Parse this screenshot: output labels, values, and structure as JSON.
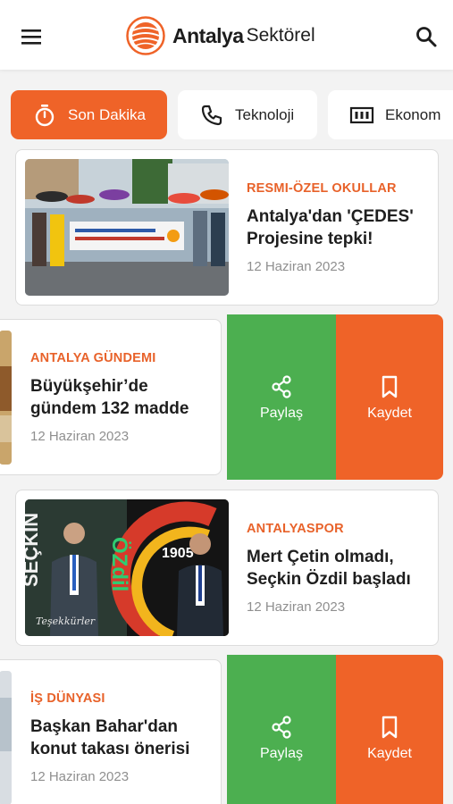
{
  "header": {
    "brand_bold": "Antalya",
    "brand_light": "Sektörel",
    "menu_icon": "hamburger-menu-icon",
    "search_icon": "search-icon"
  },
  "colors": {
    "accent": "#ef6328",
    "share_green": "#4caf50",
    "category_text": "#e8622a"
  },
  "tabs": [
    {
      "label": "Son Dakika",
      "icon": "stopwatch-icon",
      "active": true
    },
    {
      "label": "Teknoloji",
      "icon": "phone-icon",
      "active": false
    },
    {
      "label": "Ekonom",
      "icon": "currency-icon",
      "active": false
    }
  ],
  "articles": [
    {
      "category": "RESMI-ÖZEL OKULLAR",
      "title_line1": "Antalya'dan 'ÇEDES'",
      "title_line2": "Projesine tepki!",
      "date": "12 Haziran 2023",
      "image_banner": "Laik, bilimsel eğitime aykırı uygulamaları reddediyoruz!"
    },
    {
      "category": "ANTALYA GÜNDEMI",
      "title_line1": "Büyükşehir’de",
      "title_line2": "gündem 132 madde",
      "date": "12 Haziran 2023",
      "actions": {
        "share": "Paylaş",
        "save": "Kaydet"
      }
    },
    {
      "category": "ANTALYASPOR",
      "title_line1": "Mert Çetin olmadı,",
      "title_line2": "Seçkin Özdil başladı",
      "date": "12 Haziran 2023",
      "image_texts": {
        "left": "SEÇKİN",
        "center": "ÖZdil",
        "badge": "1905",
        "caption": "Teşekkürler"
      }
    },
    {
      "category": "İŞ DÜNYASI",
      "title_line1": "Başkan Bahar'dan",
      "title_line2": "konut takası önerisi",
      "date": "12 Haziran 2023",
      "actions": {
        "share": "Paylaş",
        "save": "Kaydet"
      }
    }
  ]
}
